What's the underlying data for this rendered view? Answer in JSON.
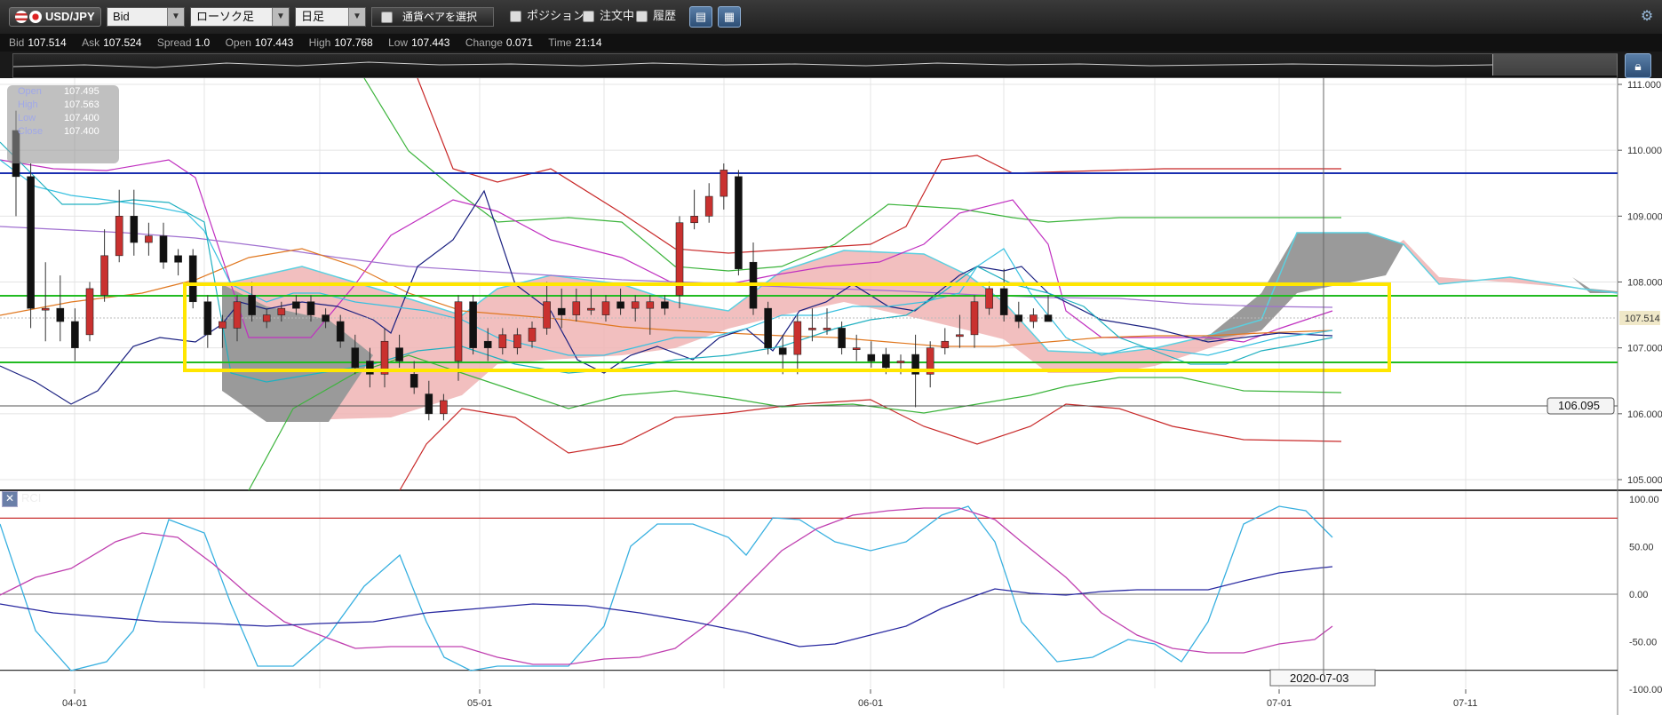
{
  "toolbar": {
    "pair": "USD/JPY",
    "price_type": "Bid",
    "chart_type": "ローソク足",
    "timeframe": "日足",
    "pair_select": "通貨ペアを選択",
    "position": "ポジション",
    "orders": "注文中",
    "history": "履歴"
  },
  "quote": {
    "bid_label": "Bid",
    "bid": "107.514",
    "ask_label": "Ask",
    "ask": "107.524",
    "spread_label": "Spread",
    "spread": "1.0",
    "open_label": "Open",
    "open": "107.443",
    "high_label": "High",
    "high": "107.768",
    "low_label": "Low",
    "low": "107.443",
    "change_label": "Change",
    "change": "0.071",
    "time_label": "Time",
    "time": "21:14"
  },
  "ohlc_box": {
    "open_label": "Open",
    "open": "107.495",
    "high_label": "High",
    "high": "107.563",
    "low_label": "Low",
    "low": "107.400",
    "close_label": "Close",
    "close": "107.400"
  },
  "price_axis": {
    "ticks": [
      "111.000",
      "110.000",
      "109.000",
      "108.000",
      "107.000",
      "106.000",
      "105.000"
    ],
    "current": "107.514",
    "marker": "106.095"
  },
  "date_axis": {
    "ticks": [
      "04-01",
      "05-01",
      "06-01",
      "07-01",
      "07-11"
    ],
    "cursor_date": "2020-07-03"
  },
  "rci": {
    "label": "RCI",
    "ticks": [
      "100.00",
      "50.00",
      "0.00",
      "-50.00",
      "-100.00"
    ]
  },
  "colors": {
    "bull": "#c9312f",
    "bear": "#111111",
    "cloud_up": "#f0b4b4",
    "cloud_down": "#9a9a9a",
    "highlight": "#ffee00",
    "hline_blue": "#1a2fb0",
    "hline_green": "#22bb22"
  },
  "chart_data": {
    "type": "candlestick",
    "price_range": [
      104.6,
      111.3
    ],
    "candles": [
      {
        "o": 110.3,
        "h": 110.6,
        "l": 109.0,
        "c": 109.6
      },
      {
        "o": 109.6,
        "h": 109.8,
        "l": 107.3,
        "c": 107.6
      },
      {
        "o": 107.6,
        "h": 108.3,
        "l": 107.1,
        "c": 107.6
      },
      {
        "o": 107.6,
        "h": 108.1,
        "l": 107.1,
        "c": 107.4
      },
      {
        "o": 107.4,
        "h": 107.6,
        "l": 106.8,
        "c": 107.0
      },
      {
        "o": 107.2,
        "h": 108.0,
        "l": 107.1,
        "c": 107.9
      },
      {
        "o": 107.8,
        "h": 108.8,
        "l": 107.7,
        "c": 108.4
      },
      {
        "o": 108.4,
        "h": 109.4,
        "l": 108.3,
        "c": 109.0
      },
      {
        "o": 109.0,
        "h": 109.4,
        "l": 108.4,
        "c": 108.6
      },
      {
        "o": 108.6,
        "h": 108.9,
        "l": 108.4,
        "c": 108.7
      },
      {
        "o": 108.7,
        "h": 108.9,
        "l": 108.2,
        "c": 108.3
      },
      {
        "o": 108.4,
        "h": 108.5,
        "l": 108.1,
        "c": 108.3
      },
      {
        "o": 108.4,
        "h": 108.5,
        "l": 107.6,
        "c": 107.7
      },
      {
        "o": 107.7,
        "h": 107.8,
        "l": 107.0,
        "c": 107.2
      },
      {
        "o": 107.3,
        "h": 107.5,
        "l": 107.0,
        "c": 107.4
      },
      {
        "o": 107.3,
        "h": 107.8,
        "l": 107.1,
        "c": 107.7
      },
      {
        "o": 107.8,
        "h": 108.0,
        "l": 107.4,
        "c": 107.5
      },
      {
        "o": 107.4,
        "h": 107.6,
        "l": 107.3,
        "c": 107.5
      },
      {
        "o": 107.5,
        "h": 107.7,
        "l": 107.4,
        "c": 107.6
      },
      {
        "o": 107.7,
        "h": 107.8,
        "l": 107.5,
        "c": 107.6
      },
      {
        "o": 107.7,
        "h": 107.8,
        "l": 107.4,
        "c": 107.5
      },
      {
        "o": 107.5,
        "h": 107.6,
        "l": 107.3,
        "c": 107.4
      },
      {
        "o": 107.4,
        "h": 107.5,
        "l": 107.0,
        "c": 107.1
      },
      {
        "o": 107.0,
        "h": 107.2,
        "l": 106.6,
        "c": 106.7
      },
      {
        "o": 106.8,
        "h": 107.0,
        "l": 106.4,
        "c": 106.6
      },
      {
        "o": 106.6,
        "h": 107.3,
        "l": 106.4,
        "c": 107.1
      },
      {
        "o": 107.0,
        "h": 107.2,
        "l": 106.7,
        "c": 106.8
      },
      {
        "o": 106.6,
        "h": 106.8,
        "l": 106.3,
        "c": 106.4
      },
      {
        "o": 106.3,
        "h": 106.5,
        "l": 105.9,
        "c": 106.0
      },
      {
        "o": 106.0,
        "h": 106.3,
        "l": 105.9,
        "c": 106.2
      },
      {
        "o": 106.8,
        "h": 107.8,
        "l": 106.5,
        "c": 107.7
      },
      {
        "o": 107.7,
        "h": 107.8,
        "l": 106.9,
        "c": 107.0
      },
      {
        "o": 107.1,
        "h": 107.3,
        "l": 106.8,
        "c": 107.0
      },
      {
        "o": 107.0,
        "h": 107.3,
        "l": 106.9,
        "c": 107.2
      },
      {
        "o": 107.0,
        "h": 107.3,
        "l": 106.9,
        "c": 107.2
      },
      {
        "o": 107.1,
        "h": 107.4,
        "l": 107.0,
        "c": 107.3
      },
      {
        "o": 107.3,
        "h": 108.0,
        "l": 107.2,
        "c": 107.7
      },
      {
        "o": 107.6,
        "h": 107.9,
        "l": 107.3,
        "c": 107.5
      },
      {
        "o": 107.5,
        "h": 107.9,
        "l": 107.4,
        "c": 107.7
      },
      {
        "o": 107.6,
        "h": 107.9,
        "l": 107.5,
        "c": 107.6
      },
      {
        "o": 107.5,
        "h": 107.8,
        "l": 107.4,
        "c": 107.7
      },
      {
        "o": 107.7,
        "h": 107.9,
        "l": 107.5,
        "c": 107.6
      },
      {
        "o": 107.6,
        "h": 107.8,
        "l": 107.4,
        "c": 107.7
      },
      {
        "o": 107.6,
        "h": 107.8,
        "l": 107.2,
        "c": 107.7
      },
      {
        "o": 107.7,
        "h": 107.8,
        "l": 107.5,
        "c": 107.6
      },
      {
        "o": 107.8,
        "h": 109.0,
        "l": 107.6,
        "c": 108.9
      },
      {
        "o": 108.9,
        "h": 109.4,
        "l": 108.8,
        "c": 109.0
      },
      {
        "o": 109.0,
        "h": 109.5,
        "l": 108.9,
        "c": 109.3
      },
      {
        "o": 109.3,
        "h": 109.8,
        "l": 109.1,
        "c": 109.7
      },
      {
        "o": 109.6,
        "h": 109.7,
        "l": 108.1,
        "c": 108.2
      },
      {
        "o": 108.3,
        "h": 108.6,
        "l": 107.5,
        "c": 107.6
      },
      {
        "o": 107.6,
        "h": 107.7,
        "l": 106.9,
        "c": 107.0
      },
      {
        "o": 107.0,
        "h": 107.2,
        "l": 106.6,
        "c": 106.9
      },
      {
        "o": 106.9,
        "h": 107.5,
        "l": 106.6,
        "c": 107.4
      },
      {
        "o": 107.3,
        "h": 107.6,
        "l": 107.1,
        "c": 107.3
      },
      {
        "o": 107.3,
        "h": 107.6,
        "l": 107.2,
        "c": 107.3
      },
      {
        "o": 107.3,
        "h": 107.4,
        "l": 106.9,
        "c": 107.0
      },
      {
        "o": 107.0,
        "h": 107.2,
        "l": 106.8,
        "c": 107.0
      },
      {
        "o": 106.9,
        "h": 107.1,
        "l": 106.7,
        "c": 106.8
      },
      {
        "o": 106.9,
        "h": 107.0,
        "l": 106.6,
        "c": 106.7
      },
      {
        "o": 106.8,
        "h": 106.9,
        "l": 106.6,
        "c": 106.8
      },
      {
        "o": 106.9,
        "h": 107.2,
        "l": 106.1,
        "c": 106.6
      },
      {
        "o": 106.6,
        "h": 107.1,
        "l": 106.4,
        "c": 107.0
      },
      {
        "o": 107.0,
        "h": 107.3,
        "l": 106.9,
        "c": 107.1
      },
      {
        "o": 107.2,
        "h": 107.5,
        "l": 107.0,
        "c": 107.2
      },
      {
        "o": 107.2,
        "h": 107.8,
        "l": 107.0,
        "c": 107.7
      },
      {
        "o": 107.6,
        "h": 108.0,
        "l": 107.5,
        "c": 107.9
      },
      {
        "o": 107.9,
        "h": 108.2,
        "l": 107.4,
        "c": 107.5
      },
      {
        "o": 107.5,
        "h": 107.7,
        "l": 107.3,
        "c": 107.4
      },
      {
        "o": 107.4,
        "h": 107.6,
        "l": 107.3,
        "c": 107.5
      },
      {
        "o": 107.5,
        "h": 107.8,
        "l": 107.4,
        "c": 107.4
      }
    ]
  }
}
